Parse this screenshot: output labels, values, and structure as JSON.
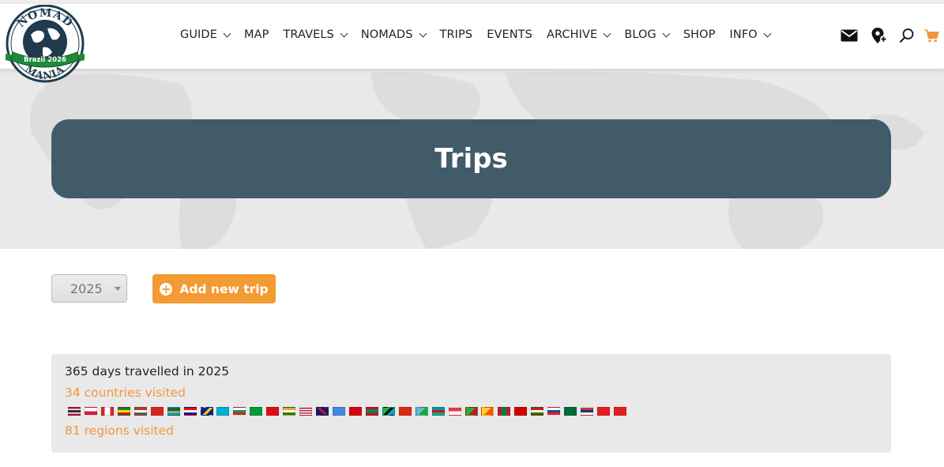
{
  "logo": {
    "top_text": "NOMAD",
    "bottom_text": "MANIA",
    "ribbon_text": "Brazil 2026"
  },
  "nav": [
    {
      "label": "GUIDE",
      "dropdown": true
    },
    {
      "label": "MAP",
      "dropdown": false
    },
    {
      "label": "TRAVELS",
      "dropdown": true
    },
    {
      "label": "NOMADS",
      "dropdown": true
    },
    {
      "label": "TRIPS",
      "dropdown": false
    },
    {
      "label": "EVENTS",
      "dropdown": false
    },
    {
      "label": "ARCHIVE",
      "dropdown": true
    },
    {
      "label": "BLOG",
      "dropdown": true
    },
    {
      "label": "SHOP",
      "dropdown": false
    },
    {
      "label": "INFO",
      "dropdown": true
    }
  ],
  "header_icons": [
    "mail-icon",
    "add-location-icon",
    "search-icon",
    "cart-icon"
  ],
  "colors": {
    "accent_orange": "#f39a33",
    "banner": "#415b69",
    "cart": "#f0973a"
  },
  "page_title": "Trips",
  "year_select": {
    "value": "2025"
  },
  "add_button": {
    "label": "Add new trip"
  },
  "stats": {
    "days_text": "365 days travelled in 2025",
    "countries_text": "34 countries visited",
    "regions_text": "81 regions visited",
    "flag_count": 34
  }
}
